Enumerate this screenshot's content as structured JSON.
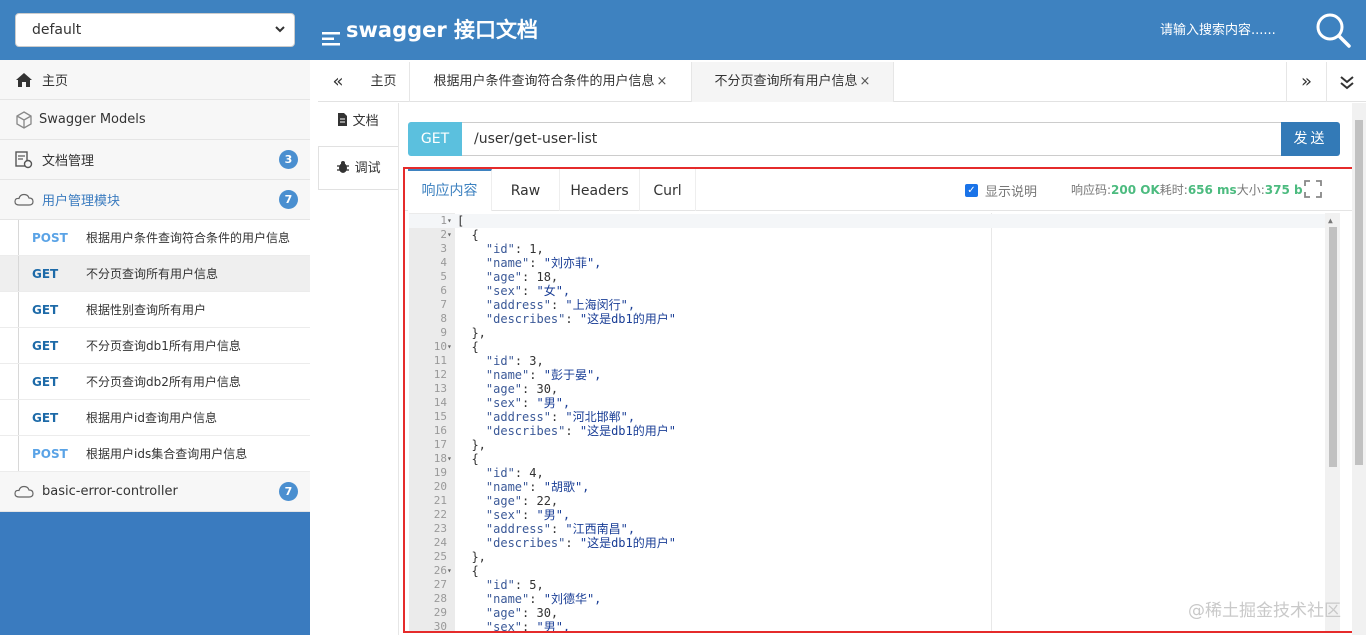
{
  "header": {
    "group_select_value": "default",
    "brand_title": "swagger 接口文档",
    "search_placeholder": "请输入搜索内容......"
  },
  "sidebar": {
    "home": "主页",
    "models": "Swagger Models",
    "doc_manage": "文档管理",
    "doc_manage_badge": "3",
    "user_module": "用户管理模块",
    "user_module_badge": "7",
    "apis": [
      {
        "method": "POST",
        "label": "根据用户条件查询符合条件的用户信息"
      },
      {
        "method": "GET",
        "label": "不分页查询所有用户信息"
      },
      {
        "method": "GET",
        "label": "根据性别查询所有用户"
      },
      {
        "method": "GET",
        "label": "不分页查询db1所有用户信息"
      },
      {
        "method": "GET",
        "label": "不分页查询db2所有用户信息"
      },
      {
        "method": "GET",
        "label": "根据用户id查询用户信息"
      },
      {
        "method": "POST",
        "label": "根据用户ids集合查询用户信息"
      }
    ],
    "error_controller": "basic-error-controller",
    "error_controller_badge": "7"
  },
  "tabs": {
    "prev": "«",
    "home": "主页",
    "tab1": "根据用户条件查询符合条件的用户信息",
    "tab2": "不分页查询所有用户信息",
    "close": "×",
    "next": "»"
  },
  "doc_tabs": {
    "doc": "文档",
    "debug": "调试"
  },
  "request": {
    "method": "GET",
    "url": "/user/get-user-list",
    "send": "发送"
  },
  "response": {
    "tabs": [
      "响应内容",
      "Raw",
      "Headers",
      "Curl"
    ],
    "show_desc": "显示说明",
    "code_label": "响应码:",
    "code_value": "200 OK",
    "time_label": "耗时:",
    "time_value": "656 ms",
    "size_label": "大小:",
    "size_value": "375 b",
    "lines": [
      "[",
      "  {",
      "    \"id\": 1,",
      "    \"name\": \"刘亦菲\",",
      "    \"age\": 18,",
      "    \"sex\": \"女\",",
      "    \"address\": \"上海闵行\",",
      "    \"describes\": \"这是db1的用户\"",
      "  },",
      "  {",
      "    \"id\": 3,",
      "    \"name\": \"彭于晏\",",
      "    \"age\": 30,",
      "    \"sex\": \"男\",",
      "    \"address\": \"河北邯郸\",",
      "    \"describes\": \"这是db1的用户\"",
      "  },",
      "  {",
      "    \"id\": 4,",
      "    \"name\": \"胡歌\",",
      "    \"age\": 22,",
      "    \"sex\": \"男\",",
      "    \"address\": \"江西南昌\",",
      "    \"describes\": \"这是db1的用户\"",
      "  },",
      "  {",
      "    \"id\": 5,",
      "    \"name\": \"刘德华\",",
      "    \"age\": 30,",
      "    \"sex\": \"男\","
    ],
    "fold_lines": [
      1,
      2,
      10,
      18,
      26
    ]
  },
  "watermark": "@稀土掘金技术社区"
}
